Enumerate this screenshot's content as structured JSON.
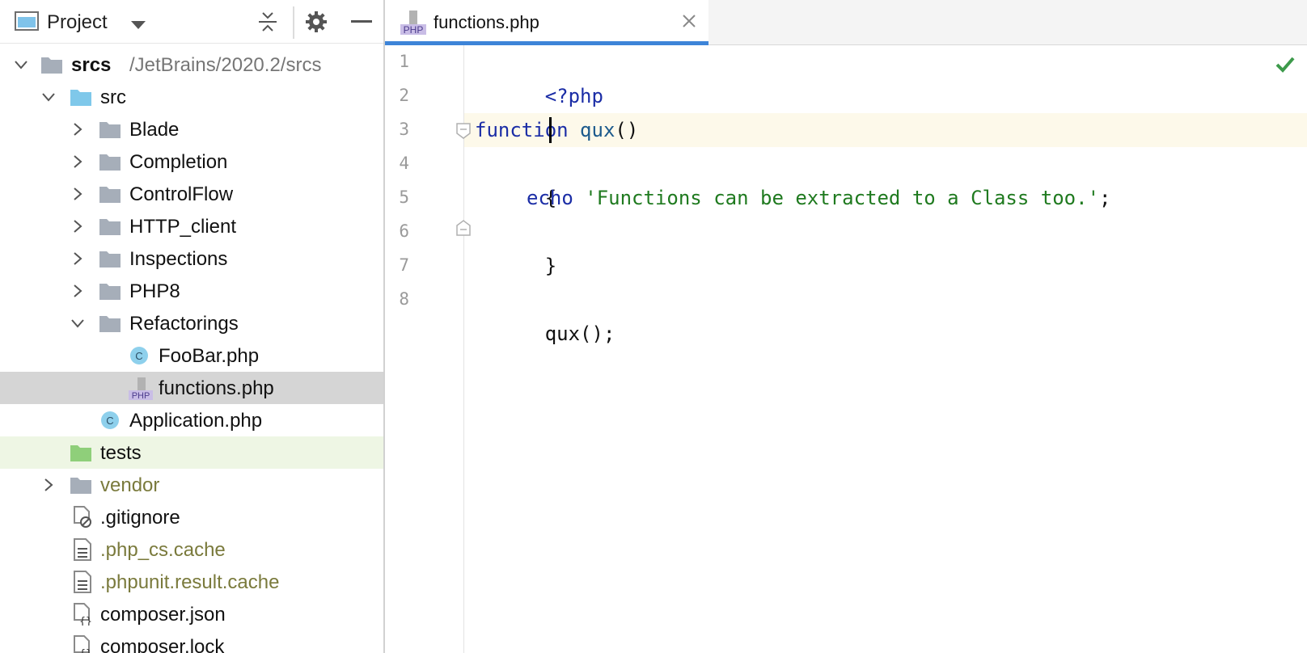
{
  "project_pane": {
    "title": "Project",
    "tree": [
      {
        "label": "srcs",
        "suffix": "/JetBrains/2020.2/srcs",
        "icon": "folder-icon",
        "expanded": true,
        "depth": 0
      },
      {
        "label": "src",
        "icon": "source-folder-icon",
        "expanded": true,
        "depth": 1
      },
      {
        "label": "Blade",
        "icon": "folder-icon",
        "expanded": false,
        "depth": 2
      },
      {
        "label": "Completion",
        "icon": "folder-icon",
        "expanded": false,
        "depth": 2
      },
      {
        "label": "ControlFlow",
        "icon": "folder-icon",
        "expanded": false,
        "depth": 2
      },
      {
        "label": "HTTP_client",
        "icon": "folder-icon",
        "expanded": false,
        "depth": 2
      },
      {
        "label": "Inspections",
        "icon": "folder-icon",
        "expanded": false,
        "depth": 2
      },
      {
        "label": "PHP8",
        "icon": "folder-icon",
        "expanded": false,
        "depth": 2
      },
      {
        "label": "Refactorings",
        "icon": "folder-icon",
        "expanded": true,
        "depth": 2
      },
      {
        "label": "FooBar.php",
        "icon": "php-class-icon",
        "depth": 3
      },
      {
        "label": "functions.php",
        "icon": "php-file-icon",
        "depth": 3,
        "selected": true
      },
      {
        "label": "Application.php",
        "icon": "php-class-icon",
        "depth": 2
      },
      {
        "label": "tests",
        "icon": "test-folder-icon",
        "depth": 1
      },
      {
        "label": "vendor",
        "icon": "folder-icon",
        "expanded": false,
        "depth": 1
      },
      {
        "label": ".gitignore",
        "icon": "ignored-file-icon",
        "depth": 1
      },
      {
        "label": ".php_cs.cache",
        "icon": "text-file-icon",
        "depth": 1
      },
      {
        "label": ".phpunit.result.cache",
        "icon": "text-file-icon",
        "depth": 1
      },
      {
        "label": "composer.json",
        "icon": "json-file-icon",
        "depth": 1
      },
      {
        "label": "composer.lock",
        "icon": "json-file-icon",
        "depth": 1
      }
    ]
  },
  "editor": {
    "tab": {
      "label": "functions.php",
      "icon_text": "PHP"
    },
    "line_numbers": [
      "1",
      "2",
      "3",
      "4",
      "5",
      "6",
      "7",
      "8"
    ],
    "code": {
      "l1": "<?php",
      "l3_kw": "function",
      "l3_name": "qux",
      "l3_rest": "()",
      "l4": "{",
      "l5_kw": "echo",
      "l5_str": "'Functions can be extracted to a Class too.'",
      "l5_end": ";",
      "l6": "}",
      "l8": "qux();"
    }
  },
  "colors": {
    "accent": "#3d84d8",
    "selection": "#d5d5d5",
    "tests_bg": "#eef6e4",
    "current_line": "#fdf9ea"
  }
}
